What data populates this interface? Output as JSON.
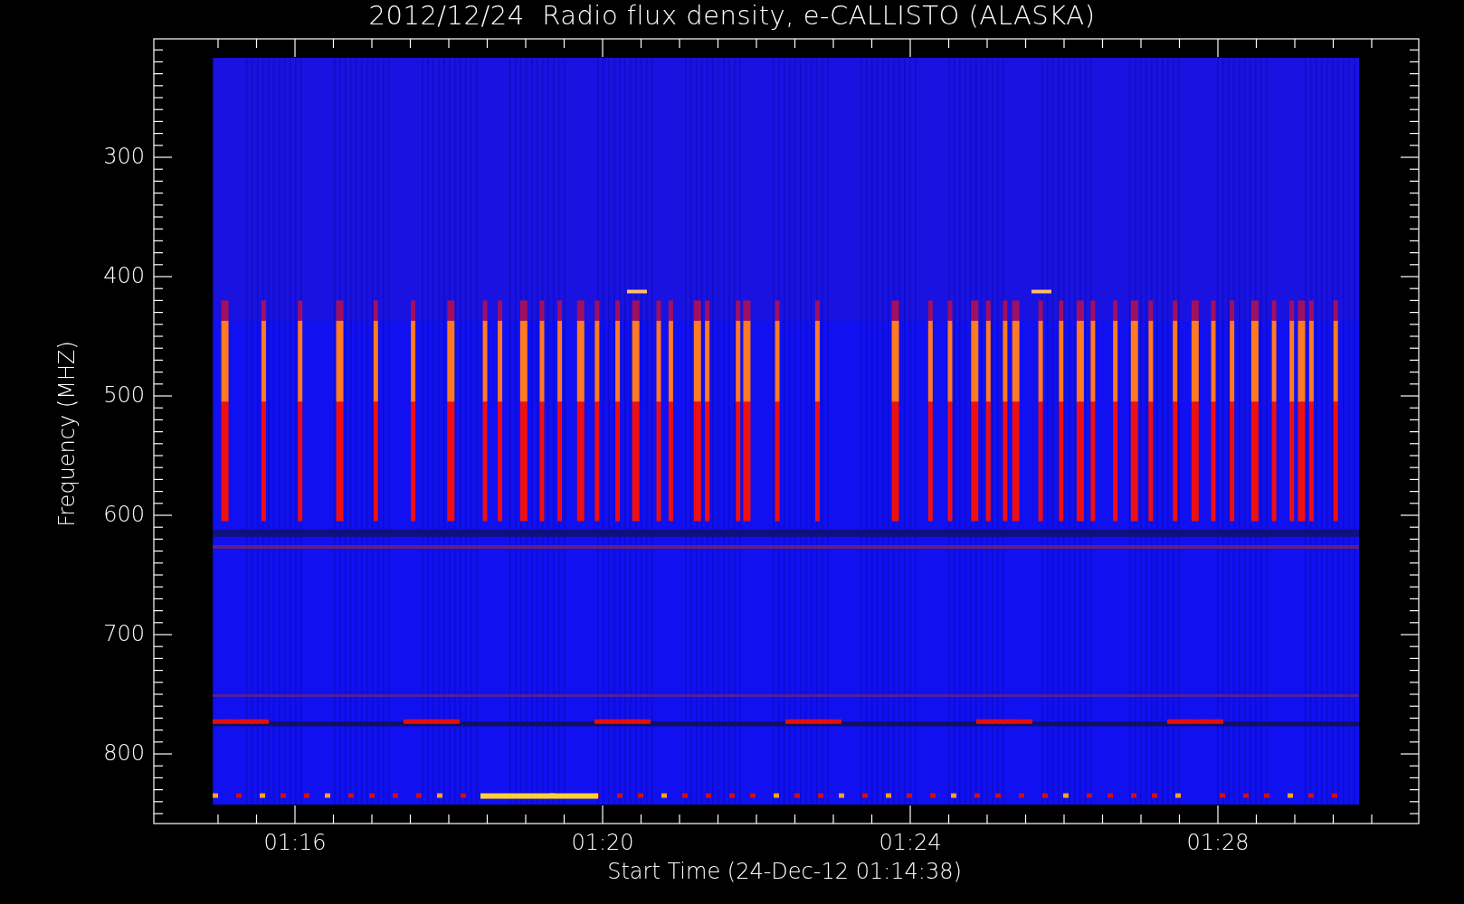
{
  "title": "2012/12/24  Radio flux density, e-CALLISTO (ALASKA)",
  "y_axis": {
    "label": "Frequency (MHZ)",
    "ticks": [
      "300",
      "400",
      "500",
      "600",
      "700",
      "800"
    ]
  },
  "x_axis": {
    "label": "Start Time (24-Dec-12 01:14:38)",
    "ticks": [
      "01:16",
      "01:20",
      "01:24",
      "01:28"
    ]
  }
}
